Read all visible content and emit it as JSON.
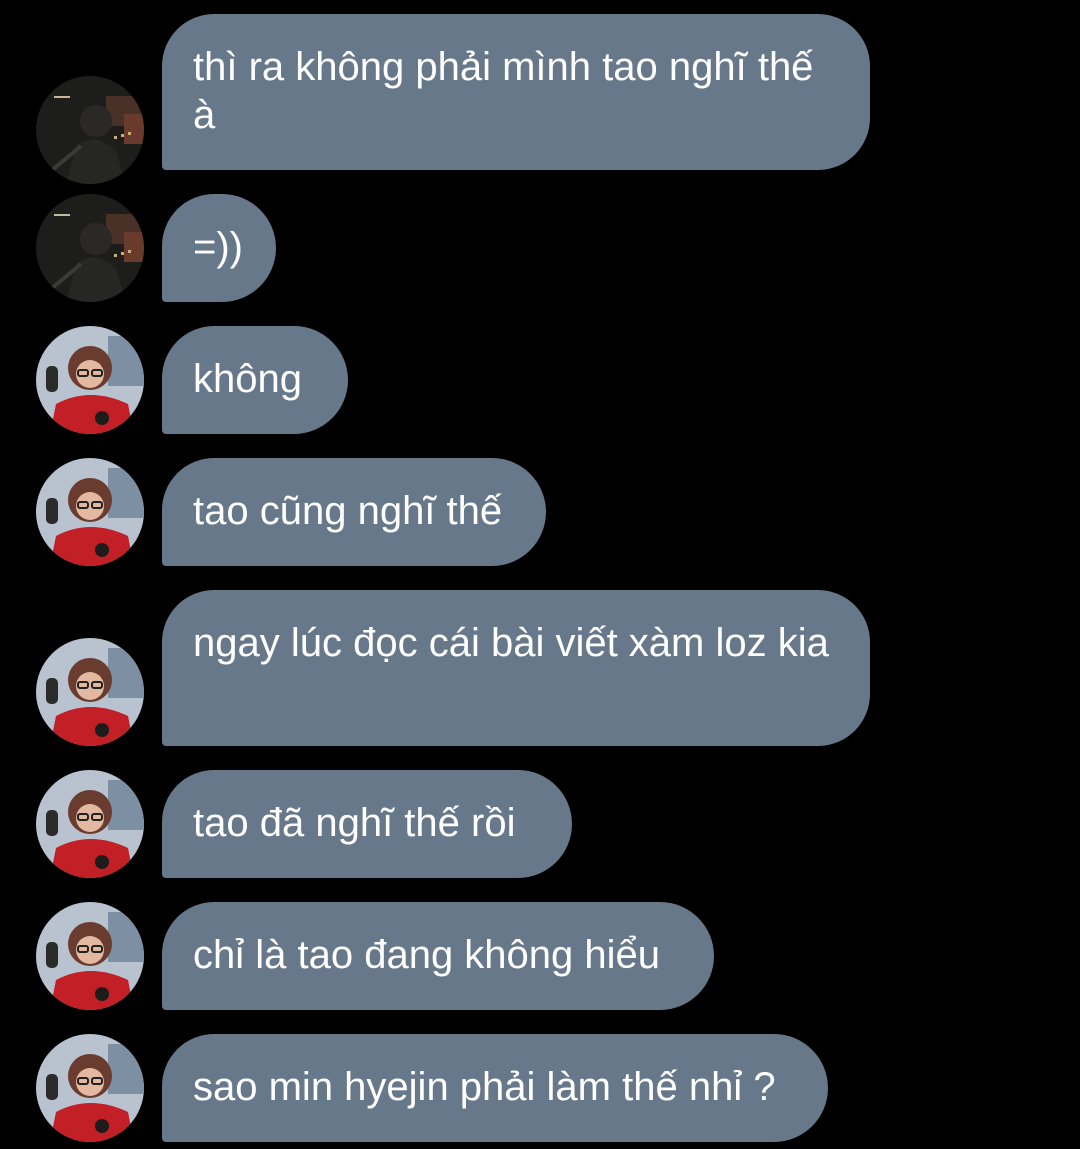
{
  "conversation": {
    "messages": [
      {
        "sender": "contact-dark",
        "text": "thì ra không phải mình tao nghĩ thế à"
      },
      {
        "sender": "contact-dark",
        "text": "=))"
      },
      {
        "sender": "contact-red",
        "text": "không"
      },
      {
        "sender": "contact-red",
        "text": "tao cũng nghĩ thế"
      },
      {
        "sender": "contact-red",
        "text": "ngay lúc đọc cái bài viết xàm loz kia"
      },
      {
        "sender": "contact-red",
        "text": "tao đã nghĩ thế rồi"
      },
      {
        "sender": "contact-red",
        "text": "chỉ là tao đang không hiểu"
      },
      {
        "sender": "contact-red",
        "text": "sao min hyejin phải làm thế nhỉ ?"
      }
    ]
  },
  "colors": {
    "background": "#000000",
    "bubble": "#67788a",
    "bubble_text": "#ffffff"
  }
}
